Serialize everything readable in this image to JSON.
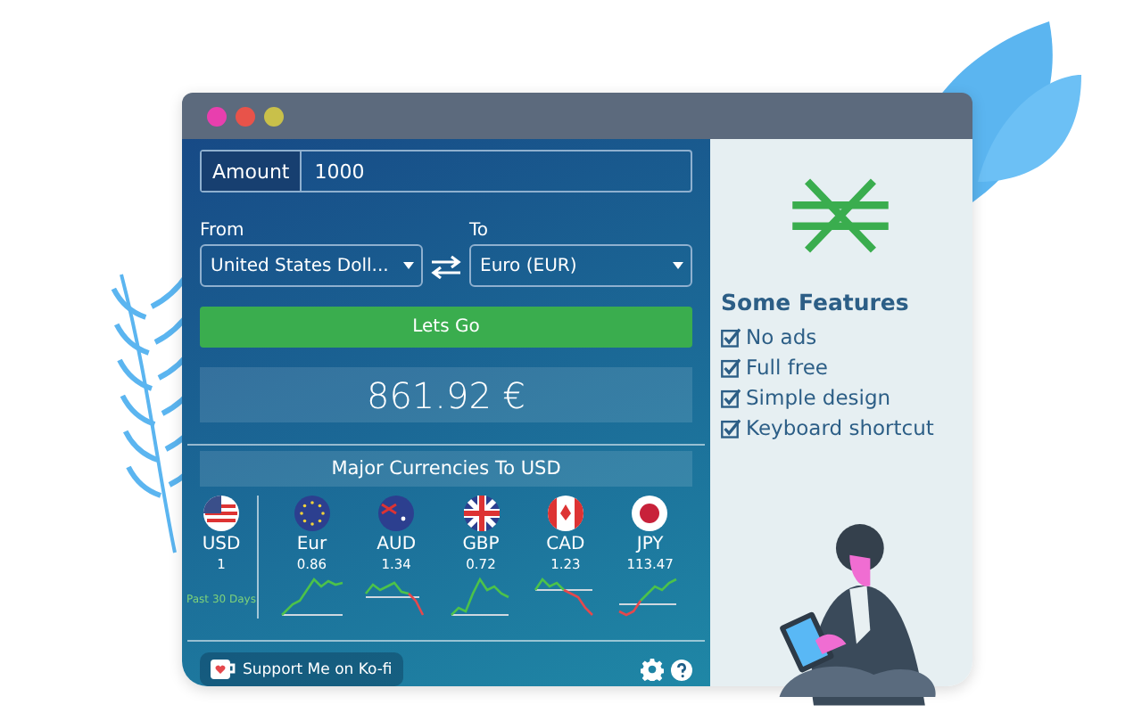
{
  "converter": {
    "amount_label": "Amount",
    "amount": "1000",
    "from_label": "From",
    "from": "United States Doll...",
    "to_label": "To",
    "to": "Euro (EUR)",
    "button": "Lets Go",
    "result": "861.92 €"
  },
  "rates": {
    "title": "Major Currencies To USD",
    "base": {
      "code": "USD",
      "value": "1"
    },
    "note": "Past 30 Days",
    "currencies": [
      {
        "code": "Eur",
        "value": "0.86"
      },
      {
        "code": "AUD",
        "value": "1.34"
      },
      {
        "code": "GBP",
        "value": "0.72"
      },
      {
        "code": "CAD",
        "value": "1.23"
      },
      {
        "code": "JPY",
        "value": "113.47"
      }
    ]
  },
  "footer": {
    "support_button": "Support Me on Ko-fi"
  },
  "features": {
    "title": "Some Features",
    "items": [
      {
        "label": "No ads",
        "checked": true
      },
      {
        "label": "Full free",
        "checked": true
      },
      {
        "label": "Simple design",
        "checked": true
      },
      {
        "label": "Keyboard shortcut",
        "checked": true
      }
    ]
  }
}
